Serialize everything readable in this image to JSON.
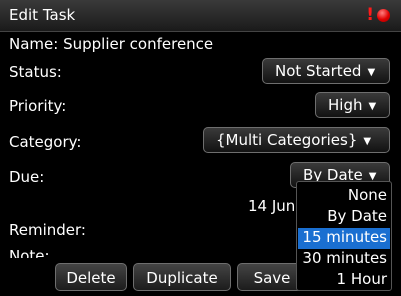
{
  "window": {
    "title": "Edit Task"
  },
  "task": {
    "name_label": "Name:",
    "name_value": "Supplier conference",
    "status_label": "Status:",
    "status_value": "Not Started",
    "priority_label": "Priority:",
    "priority_value": "High",
    "category_label": "Category:",
    "category_value": "{Multi Categories}",
    "due_label": "Due:",
    "due_value": "By Date",
    "due_date": "14 Jun",
    "reminder_label": "Reminder:",
    "note_label": "Note:"
  },
  "reminder_dropdown": {
    "options": [
      "None",
      "By Date",
      "15 minutes",
      "30 minutes",
      "1 Hour"
    ],
    "selected": "15 minutes"
  },
  "buttons": {
    "delete": "Delete",
    "duplicate": "Duplicate",
    "save": "Save"
  },
  "icons": {
    "alert": "red-alert-icon",
    "caret": "▼"
  },
  "colors": {
    "selection": "#1a6fd1",
    "alert": "#ff1a1a"
  }
}
